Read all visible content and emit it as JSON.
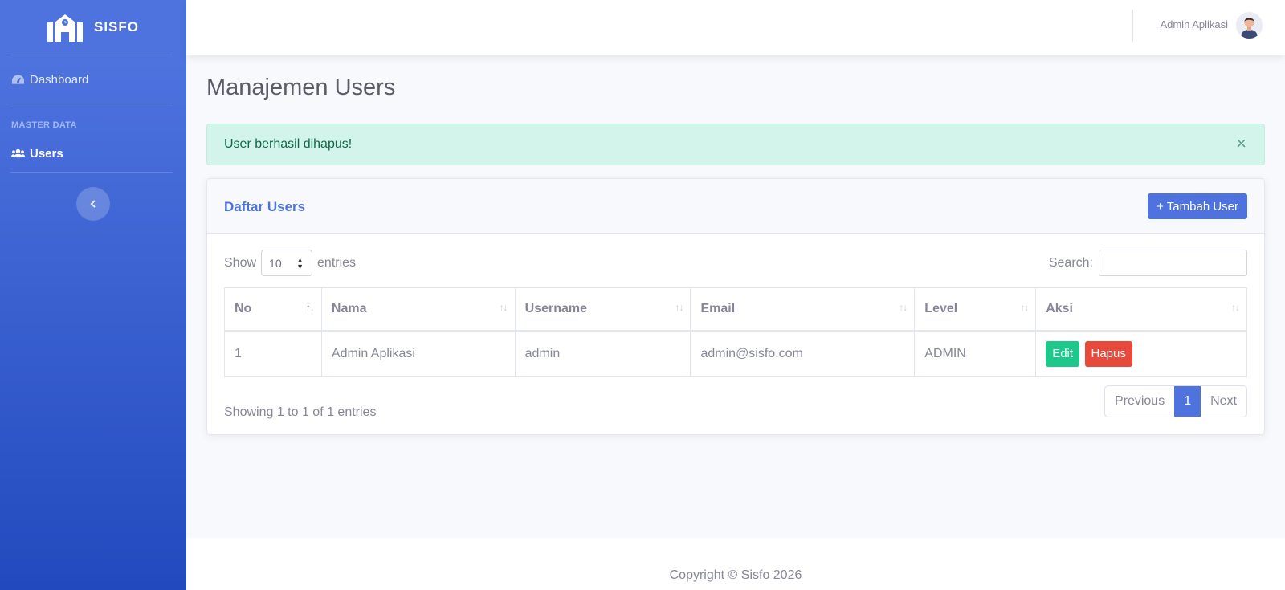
{
  "brand": {
    "name": "SISFO"
  },
  "sidebar": {
    "items": [
      {
        "label": "Dashboard",
        "icon": "tachometer-icon"
      },
      {
        "label": "Users",
        "icon": "users-icon"
      }
    ],
    "heading": "MASTER DATA"
  },
  "topbar": {
    "user_name": "Admin Aplikasi"
  },
  "page": {
    "title": "Manajemen Users"
  },
  "alert": {
    "message": "User berhasil dihapus!",
    "close": "×"
  },
  "card": {
    "title": "Daftar Users",
    "add_button": "+ Tambah User"
  },
  "datatable": {
    "show_label": "Show",
    "entries_label": "entries",
    "length_value": "10",
    "search_label": "Search:",
    "search_value": "",
    "columns": [
      "No",
      "Nama",
      "Username",
      "Email",
      "Level",
      "Aksi"
    ],
    "rows": [
      {
        "no": "1",
        "nama": "Admin Aplikasi",
        "username": "admin",
        "email": "admin@sisfo.com",
        "level": "ADMIN"
      }
    ],
    "edit_label": "Edit",
    "delete_label": "Hapus",
    "info": "Showing 1 to 1 of 1 entries",
    "pagination": {
      "previous": "Previous",
      "current": "1",
      "next": "Next"
    }
  },
  "footer": {
    "text": "Copyright © Sisfo 2026"
  },
  "colors": {
    "primary": "#4e73df",
    "success": "#1cc88a",
    "danger": "#e74a3b",
    "alert_bg": "#d2f4ea"
  }
}
